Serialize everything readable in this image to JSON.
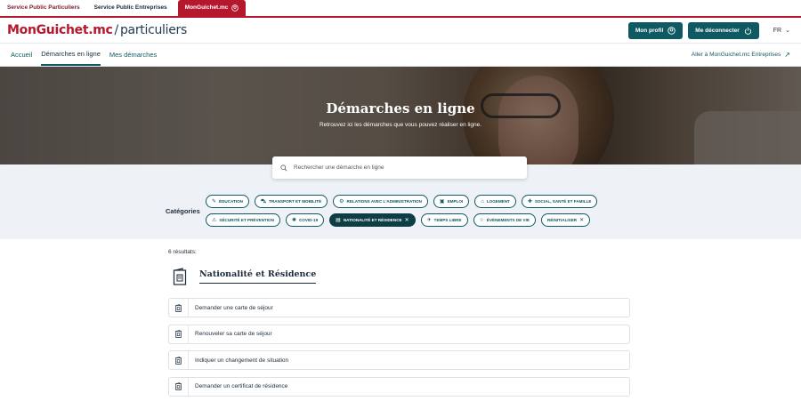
{
  "topbar": {
    "tabs": [
      "Service Public Particuliers",
      "Service Public Entreprises"
    ],
    "active_tab": "MonGuichet.mc"
  },
  "header": {
    "logo_brand": "MonGuichet.mc",
    "logo_sep": "/",
    "logo_sub": "particuliers",
    "profile_button": "Mon profil",
    "logout_button": "Me déconnecter",
    "language": "FR"
  },
  "nav": {
    "items": [
      "Accueil",
      "Démarches en ligne",
      "Mes démarches"
    ],
    "active_index": 1,
    "external_link": "Aller à MonGuichet.mc Entreprises"
  },
  "hero": {
    "title": "Démarches en ligne",
    "subtitle": "Retrouvez ici les démarches que vous pouvez réaliser en ligne."
  },
  "search": {
    "placeholder": "Rechercher une démarche en ligne"
  },
  "categories": {
    "label": "Catégories",
    "row1": [
      {
        "label": "ÉDUCATION",
        "icon": "education-icon",
        "glyph": "✎"
      },
      {
        "label": "TRANSPORT ET MOBILITÉ",
        "icon": "transport-icon",
        "glyph": "⛍"
      },
      {
        "label": "RELATIONS AVEC L'ADMINISTRATION",
        "icon": "administration-icon",
        "glyph": "⚙"
      },
      {
        "label": "EMPLOI",
        "icon": "briefcase-icon",
        "glyph": "▣"
      },
      {
        "label": "LOGEMENT",
        "icon": "house-icon",
        "glyph": "⌂"
      },
      {
        "label": "SOCIAL, SANTÉ ET FAMILLE",
        "icon": "health-icon",
        "glyph": "✚"
      }
    ],
    "row2": [
      {
        "label": "SÉCURITÉ ET PRÉVENTION",
        "icon": "security-icon",
        "glyph": "⚠",
        "active": false
      },
      {
        "label": "COVID-19",
        "icon": "virus-icon",
        "glyph": "✺",
        "active": false
      },
      {
        "label": "NATIONALITÉ ET RÉSIDENCE",
        "icon": "passport-icon",
        "glyph": "▤",
        "active": true
      },
      {
        "label": "TEMPS LIBRE",
        "icon": "leisure-icon",
        "glyph": "✈",
        "active": false
      },
      {
        "label": "ÉVÉNEMENTS DE VIE",
        "icon": "star-icon",
        "glyph": "☆",
        "active": false
      },
      {
        "label": "RÉINITIALISER",
        "icon": "close-icon",
        "glyph": "✕",
        "active": false
      }
    ]
  },
  "results": {
    "count": "6 résultats:",
    "section_title": "Nationalité et Résidence",
    "items": [
      "Demander une carte de séjour",
      "Renouveler sa carte de séjour",
      "Indiquer un changement de situation",
      "Demander un certificat de résidence"
    ]
  },
  "colors": {
    "accent": "#0f5a62",
    "brand": "#b5172c",
    "active_chip": "#0d3e45"
  }
}
